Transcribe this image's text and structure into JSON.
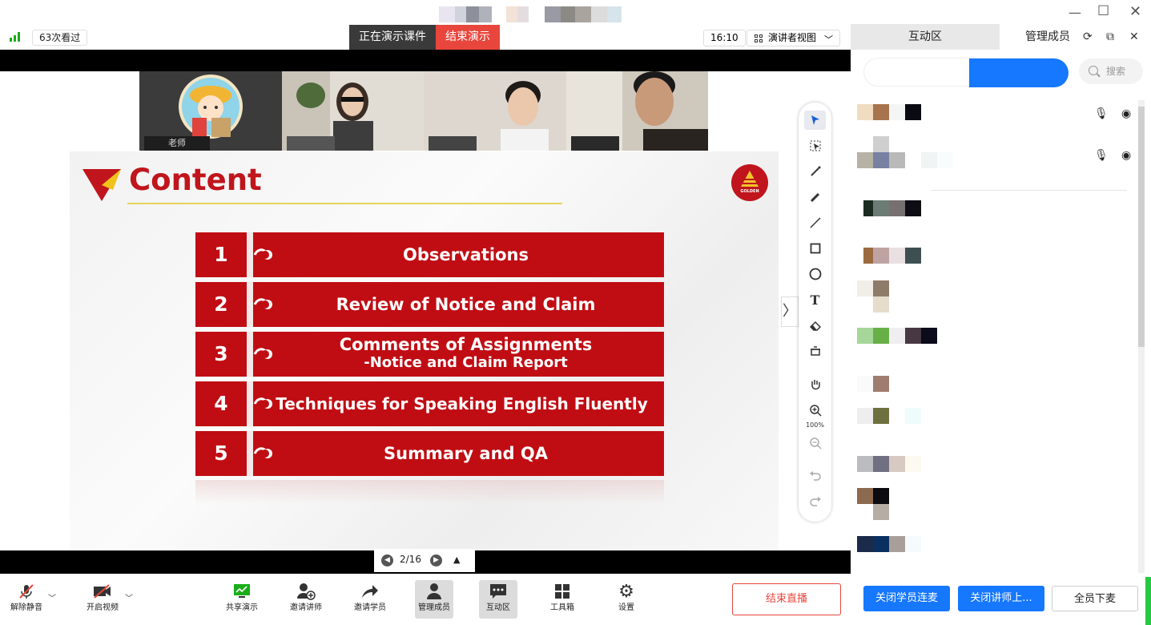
{
  "topbar": {
    "viewers": "63次看过",
    "presenting_label": "正在演示课件",
    "end_presenting": "结束演示",
    "time": "16:10",
    "view_mode": "演讲者视图"
  },
  "videos": [
    {
      "name": "老师"
    },
    {
      "name": ""
    },
    {
      "name": ""
    },
    {
      "name": ""
    }
  ],
  "slide": {
    "title": "Content",
    "logo_text": "GOLDEN",
    "items": [
      {
        "num": "1",
        "label": "Observations"
      },
      {
        "num": "2",
        "label": "Review of Notice and Claim"
      },
      {
        "num": "3",
        "label": "Comments of Assignments",
        "sub": "-Notice and Claim Report"
      },
      {
        "num": "4",
        "label": "Techniques for Speaking English Fluently"
      },
      {
        "num": "5",
        "label": "Summary and QA"
      }
    ]
  },
  "toolbar": {
    "zoom": "100%"
  },
  "pager": {
    "page": "2/16"
  },
  "bottom": {
    "unmute": "解除静音",
    "start_video": "开启视频",
    "share": "共享演示",
    "invite_lecturer": "邀请讲师",
    "invite_student": "邀请学员",
    "manage_members": "管理成员",
    "interaction": "互动区",
    "toolbox": "工具箱",
    "settings": "设置",
    "end_live": "结束直播"
  },
  "right_panel": {
    "tab_interaction": "互动区",
    "tab_members": "管理成员",
    "search_placeholder": "搜索",
    "btn_close_student_mic": "关闭学员连麦",
    "btn_close_lecturer": "关闭讲师上...",
    "btn_all_mic_off": "全员下麦"
  },
  "colors": {
    "slide_red": "#c00d13",
    "accent_red": "#e8463c",
    "blue": "#1677ff"
  }
}
